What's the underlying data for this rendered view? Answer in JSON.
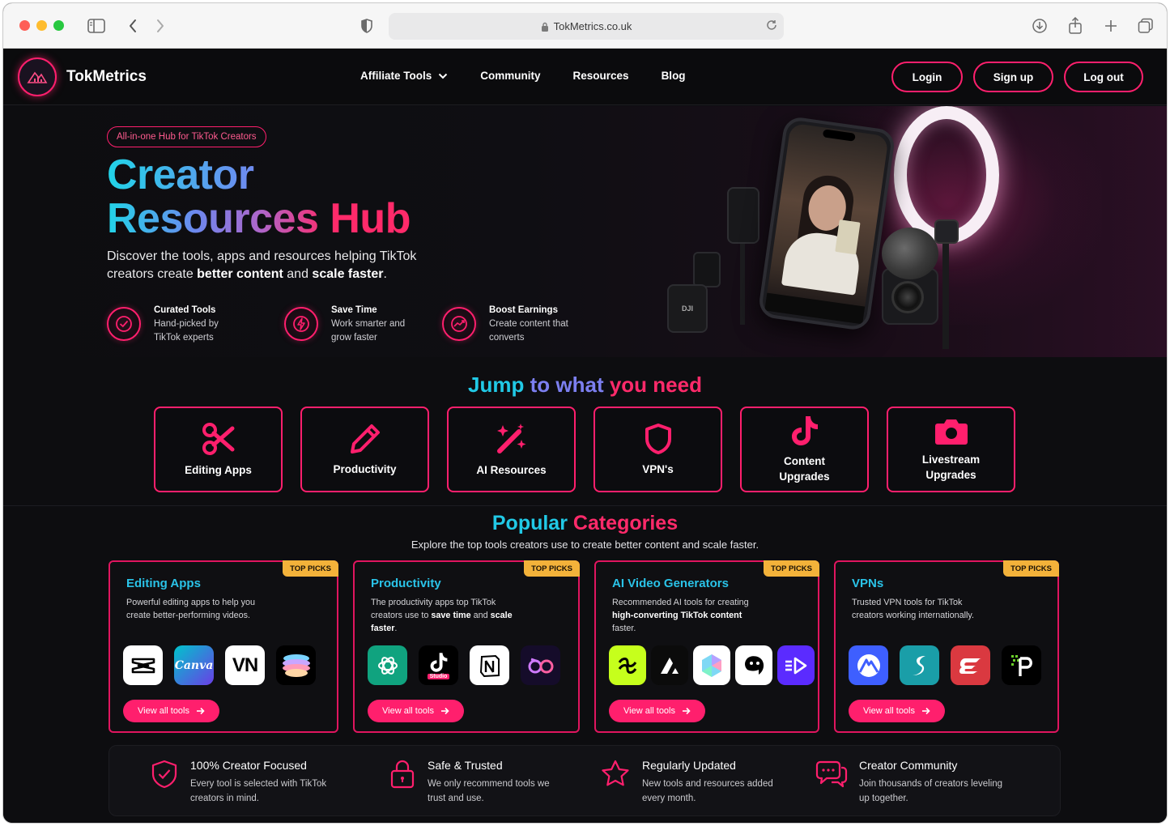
{
  "browser": {
    "url": "TokMetrics.co.uk"
  },
  "nav": {
    "brand": "TokMetrics",
    "links": [
      "Affiliate Tools",
      "Community",
      "Resources",
      "Blog"
    ],
    "buttons": [
      "Login",
      "Sign up",
      "Log out"
    ]
  },
  "hero": {
    "badge": "All-in-one Hub for TikTok Creators",
    "title_line1": "Creator",
    "title_line2a": "Resources ",
    "title_line2b": "Hub",
    "desc_part1": "Discover the tools, apps and resources helping TikTok creators create ",
    "desc_bold1": "better content",
    "desc_part2": " and ",
    "desc_bold2": "scale faster",
    "desc_part3": ".",
    "features": [
      {
        "icon": "check-circle-icon",
        "title": "Curated Tools",
        "line1": "Hand-picked by",
        "line2": "TikTok experts"
      },
      {
        "icon": "lightning-icon",
        "title": "Save Time",
        "line1": "Work smarter and",
        "line2": "grow faster"
      },
      {
        "icon": "growth-chart-icon",
        "title": "Boost Earnings",
        "line1": "Create content that",
        "line2": "converts"
      }
    ]
  },
  "jump": {
    "title_a": "Jump ",
    "title_b": "to what ",
    "title_c": "you need",
    "tiles": [
      {
        "icon": "scissors-icon",
        "label": "Editing Apps"
      },
      {
        "icon": "pencil-icon",
        "label": "Productivity"
      },
      {
        "icon": "magic-wand-icon",
        "label": "AI Resources"
      },
      {
        "icon": "shield-icon",
        "label": "VPN's"
      },
      {
        "icon": "tiktok-icon",
        "label": "Content\nUpgrades"
      },
      {
        "icon": "camera-icon",
        "label": "Livestream\nUpgrades"
      }
    ]
  },
  "popular": {
    "title_a": "Popular ",
    "title_b": "Categories",
    "subtitle": "Explore the top tools creators use to create better content and scale faster.",
    "top_picks": "TOP PICKS",
    "view_all": "View all tools",
    "cards": [
      {
        "title": "Editing Apps",
        "desc": "Powerful editing apps to help you create better-performing videos.",
        "apps": [
          "capcut-icon",
          "canva-icon",
          "vn-icon",
          "prequel-icon"
        ]
      },
      {
        "title": "Productivity",
        "desc_a": "The productivity apps top TikTok creators use to ",
        "desc_b": "save time",
        "desc_c": " and ",
        "desc_d": "scale faster",
        "desc_e": ".",
        "apps": [
          "chatgpt-icon",
          "tiktok-studio-icon",
          "notion-icon",
          "vidiq-icon"
        ]
      },
      {
        "title": "AI Video Generators",
        "desc_a": "Recommended AI tools for creating ",
        "desc_b": "high-converting TikTok content",
        "desc_c": " faster.",
        "apps": [
          "zebracat-icon",
          "arcads-icon",
          "pictory-icon",
          "creatify-icon",
          "invideo-icon"
        ]
      },
      {
        "title": "VPNs",
        "desc": "Trusted VPN tools for TikTok creators working internationally.",
        "apps": [
          "nordvpn-icon",
          "surfshark-icon",
          "expressvpn-icon",
          "ipvanish-icon"
        ]
      }
    ],
    "app_labels": {
      "canva": "Canva",
      "vn": "VN",
      "tiktok_studio": "Studio"
    }
  },
  "strip": [
    {
      "icon": "shield-check-icon",
      "title": "100% Creator Focused",
      "line1": "Every tool is selected with TikTok",
      "line2": "creators in mind."
    },
    {
      "icon": "lock-icon",
      "title": "Safe & Trusted",
      "line1": "We only recommend tools we",
      "line2": "trust and use."
    },
    {
      "icon": "star-icon",
      "title": "Regularly Updated",
      "line1": "New tools and resources added",
      "line2": "every month."
    },
    {
      "icon": "chat-icon",
      "title": "Creator Community",
      "line1": "Join thousands of creators leveling",
      "line2": "up together."
    }
  ],
  "colors": {
    "accent": "#ff1f6d",
    "cyan": "#21c9e6",
    "gold": "#f3b23a"
  }
}
